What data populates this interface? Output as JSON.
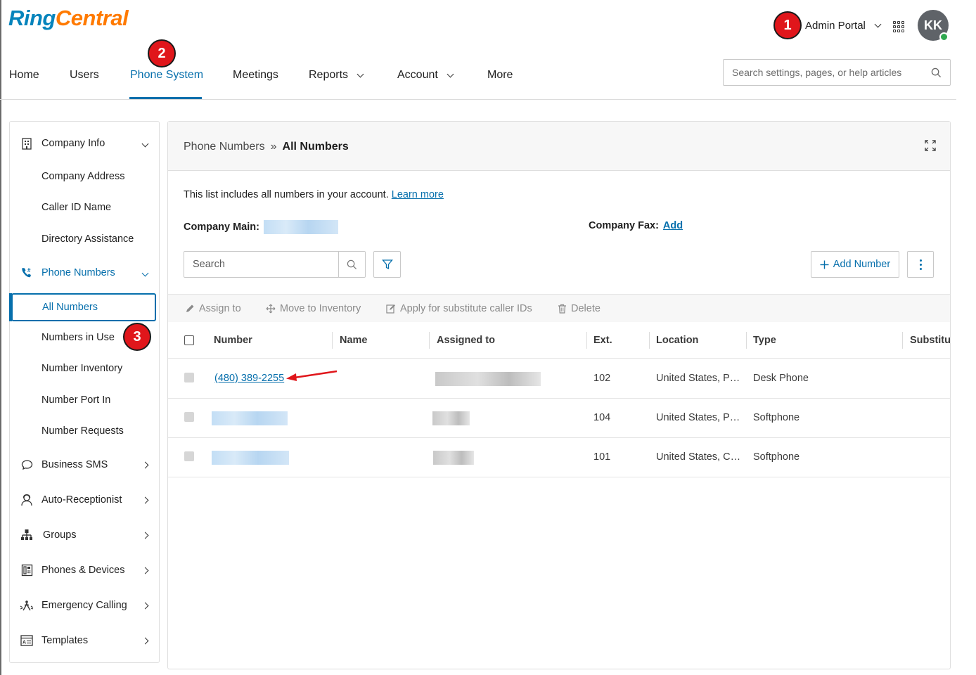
{
  "app": {
    "logo_ring": "Ring",
    "logo_central": "Central",
    "admin_portal_label": "Admin Portal",
    "avatar_initials": "KK"
  },
  "annotations": [
    "1",
    "2",
    "3"
  ],
  "nav": {
    "items": [
      {
        "label": "Home"
      },
      {
        "label": "Users"
      },
      {
        "label": "Phone System"
      },
      {
        "label": "Meetings"
      },
      {
        "label": "Reports"
      },
      {
        "label": "Account"
      },
      {
        "label": "More"
      }
    ],
    "search_placeholder": "Search settings, pages, or help articles"
  },
  "sidebar": {
    "items": [
      {
        "label": "Company Info"
      },
      {
        "label": "Company Address"
      },
      {
        "label": "Caller ID Name"
      },
      {
        "label": "Directory Assistance"
      },
      {
        "label": "Phone Numbers"
      },
      {
        "label": "All Numbers"
      },
      {
        "label": "Numbers in Use"
      },
      {
        "label": "Number Inventory"
      },
      {
        "label": "Number Port In"
      },
      {
        "label": "Number Requests"
      },
      {
        "label": "Business SMS"
      },
      {
        "label": "Auto-Receptionist"
      },
      {
        "label": "Groups"
      },
      {
        "label": "Phones & Devices"
      },
      {
        "label": "Emergency Calling"
      },
      {
        "label": "Templates"
      }
    ]
  },
  "main": {
    "breadcrumb_parent": "Phone Numbers",
    "breadcrumb_sep": "»",
    "breadcrumb_current": "All Numbers",
    "intro_text": "This list includes all numbers in your account. ",
    "learn_more": "Learn more",
    "company_main_label": "Company Main:",
    "company_fax_label": "Company Fax:",
    "company_fax_link": "Add",
    "search_placeholder": "Search",
    "add_number_label": "Add Number",
    "actions": {
      "assign": "Assign to",
      "move": "Move to Inventory",
      "apply": "Apply for substitute caller IDs",
      "delete": "Delete"
    },
    "table": {
      "headers": [
        "Number",
        "Name",
        "Assigned to",
        "Ext.",
        "Location",
        "Type",
        "Substitu"
      ],
      "rows": [
        {
          "number": "(480) 389-2255",
          "ext": "102",
          "location": "United States, P…",
          "type": "Desk Phone"
        },
        {
          "number": "",
          "ext": "104",
          "location": "United States, P…",
          "type": "Softphone"
        },
        {
          "number": "",
          "ext": "101",
          "location": "United States, C…",
          "type": "Softphone"
        }
      ]
    }
  },
  "colors": {
    "accent": "#066fac",
    "annotation_red": "#e0161b",
    "logo_orange": "#ff7a00"
  }
}
